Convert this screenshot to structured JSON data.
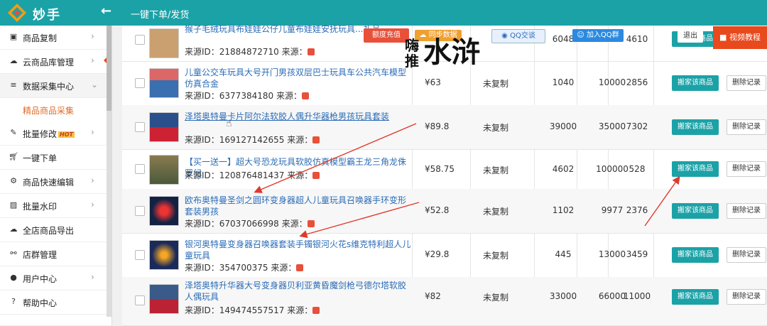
{
  "app": {
    "name": "妙手",
    "breadcrumb": "一键下单/发货"
  },
  "sidebar": {
    "items": [
      {
        "icon": "copy-icon",
        "label": "商品复制"
      },
      {
        "icon": "cloud-icon",
        "label": "云商品库管理"
      },
      {
        "icon": "database-icon",
        "label": "数据采集中心"
      },
      {
        "icon": "edit-icon",
        "label": "批量修改",
        "badge": "HOT"
      },
      {
        "icon": "cart-icon",
        "label": "一键下单"
      },
      {
        "icon": "gears-icon",
        "label": "商品快速编辑"
      },
      {
        "icon": "image-icon",
        "label": "批量水印"
      },
      {
        "icon": "cloud-upload-icon",
        "label": "全店商品导出"
      },
      {
        "icon": "sitemap-icon",
        "label": "店群管理"
      },
      {
        "icon": "user-icon",
        "label": "用户中心"
      },
      {
        "icon": "help-icon",
        "label": "帮助中心"
      }
    ],
    "sub_item": "精品商品采集"
  },
  "overlays": {
    "recharge": "额度充值",
    "sync": "同步数据",
    "qq_chat": "QQ交谈",
    "join_qq": "加入QQ群",
    "logout": "退出",
    "video_tutorial": "视频教程",
    "watermark_small": [
      "嗨",
      "推"
    ],
    "watermark_big": "水浒"
  },
  "source_label": "来源ID：",
  "source_suffix": "来源：",
  "status_text": "未复制",
  "buttons": {
    "move": "搬家该商品",
    "delete": "删除记录"
  },
  "rows": [
    {
      "title": "猴子毛绒玩具布娃娃公仔儿童布娃娃安抚玩具...礼品",
      "id": "21884872710",
      "price": "",
      "n1": "6048",
      "n2": "",
      "n3": "4610"
    },
    {
      "title": "儿童公交车玩具大号开门男孩双层巴士玩具车公共汽车模型仿真合金",
      "id": "6377384180",
      "price": "¥63",
      "n1": "1040",
      "n2": "10000",
      "n3": "2856"
    },
    {
      "title": "泽塔奥特曼卡片阿尔法软胶人偶升华器枪男孩玩具套装",
      "id": "169127142655",
      "price": "¥89.8",
      "n1": "39000",
      "n2": "35000",
      "n3": "7302"
    },
    {
      "title": "【买一送一】超大号恐龙玩具软胶仿真模型霸王龙三角龙侏罗纪",
      "id": "120876481437",
      "price": "¥58.75",
      "n1": "4602",
      "n2": "100000",
      "n3": "528"
    },
    {
      "title": "欧布奥特曼圣剑之圆环变身器超人儿童玩具召唤器手环变形套装男孩",
      "id": "67037066998",
      "price": "¥52.8",
      "n1": "1102",
      "n2": "9977",
      "n3": "2376"
    },
    {
      "title": "银河奥特曼变身器召唤器套装手镯银河火花s维克特利超人儿童玩具",
      "id": "354700375",
      "price": "¥29.8",
      "n1": "445",
      "n2": "13000",
      "n3": "3459"
    },
    {
      "title": "泽塔奥特升华器大号变身器贝利亚黄昏魔剑枪弓德尔塔软胶人偶玩具",
      "id": "149474557517",
      "price": "¥82",
      "n1": "33000",
      "n2": "66000",
      "n3": "11000"
    }
  ],
  "colors": {
    "primary": "#1ba2a7",
    "accent": "#e8491d",
    "link": "#2b6cb7",
    "arrow": "#e0392b"
  }
}
